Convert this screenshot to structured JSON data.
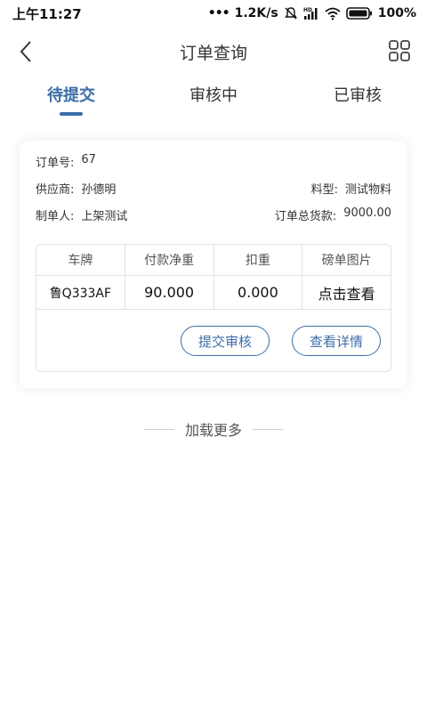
{
  "status_bar": {
    "time": "上午11:27",
    "net_speed": "1.2K/s",
    "battery": "100%"
  },
  "header": {
    "title": "订单查询"
  },
  "tabs": [
    {
      "label": "待提交",
      "active": true
    },
    {
      "label": "审核中",
      "active": false
    },
    {
      "label": "已审核",
      "active": false
    }
  ],
  "order": {
    "order_no_label": "订单号:",
    "order_no": "67",
    "supplier_label": "供应商:",
    "supplier": "孙德明",
    "material_type_label": "料型:",
    "material_type": "测试物料",
    "creator_label": "制单人:",
    "creator": "上架测试",
    "total_label": "订单总货款:",
    "total": "9000.00",
    "table": {
      "headers": [
        "车牌",
        "付款净重",
        "扣重",
        "磅单图片"
      ],
      "row": [
        "鲁Q333AF",
        "90.000",
        "0.000",
        "点击查看"
      ]
    },
    "submit_label": "提交审核",
    "detail_label": "查看详情"
  },
  "load_more": "加载更多",
  "colors": {
    "accent": "#3b6ea8"
  }
}
